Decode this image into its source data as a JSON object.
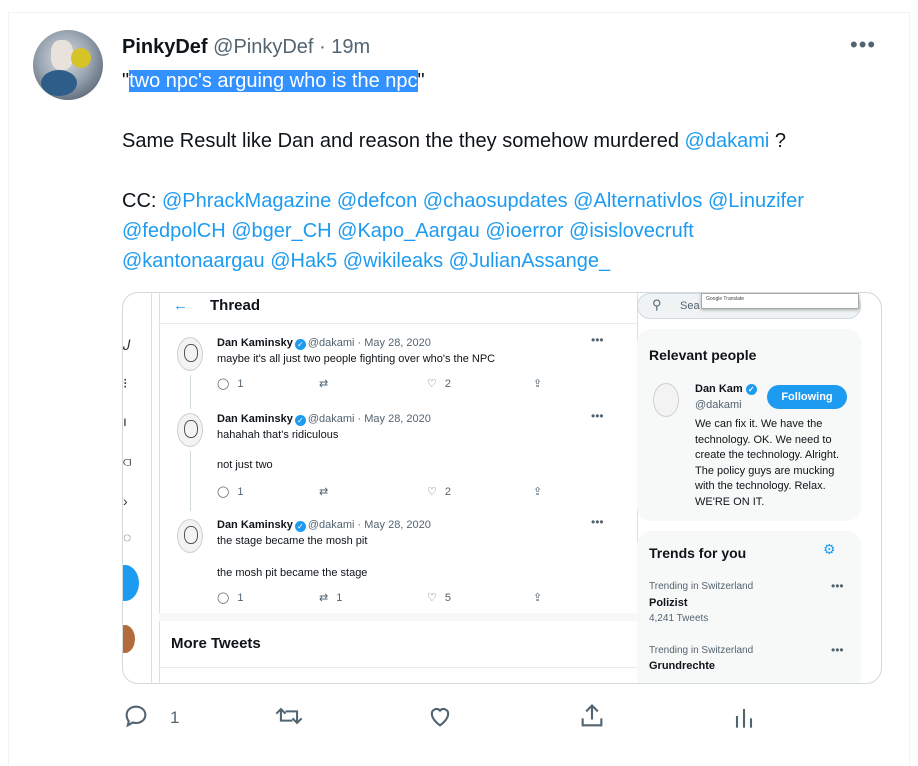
{
  "tweet": {
    "author_name": "PinkyDef",
    "author_handle": "@PinkyDef",
    "separator": "·",
    "time": "19m",
    "more_icon": "more-horizontal-icon",
    "line1_open_quote": "\"",
    "line1_highlight": "two npc's arguing who is the npc",
    "line1_close_quote": "\"",
    "line2_text": "Same Result like Dan and reason the they somehow murdered ",
    "line2_mention": "@dakami",
    "line2_suffix": " ?",
    "cc_label": "CC: ",
    "cc_line1": [
      "@PhrackMagazine",
      "@defcon",
      "@chaosupdates",
      "@Alternativlos",
      "@Linuzifer"
    ],
    "cc_line2": [
      "@fedpolCH",
      "@bger_CH",
      "@Kapo_Aargau",
      "@ioerror",
      "@isislovecruft"
    ],
    "cc_line3": [
      "@kantonaargau",
      "@Hak5",
      "@wikileaks",
      "@JulianAssange_"
    ],
    "actions": {
      "reply_count": "1",
      "reply_icon": "reply-icon",
      "retweet_icon": "retweet-icon",
      "like_icon": "like-icon",
      "share_icon": "share-icon",
      "analytics_icon": "analytics-icon"
    }
  },
  "embedded_screenshot": {
    "thread_title": "Thread",
    "back_icon": "←",
    "tweets": [
      {
        "name": "Dan Kaminsky",
        "handle": "@dakami",
        "date": "May 28, 2020",
        "body": [
          "maybe it's all just two people fighting over who's the NPC"
        ],
        "replies": "1",
        "retweets": "",
        "likes": "2"
      },
      {
        "name": "Dan Kaminsky",
        "handle": "@dakami",
        "date": "May 28, 2020",
        "body": [
          "hahahah that's ridiculous",
          "not just two"
        ],
        "replies": "1",
        "retweets": "",
        "likes": "2"
      },
      {
        "name": "Dan Kaminsky",
        "handle": "@dakami",
        "date": "May 28, 2020",
        "body": [
          "the stage became the mosh pit",
          "the mosh pit became the stage"
        ],
        "replies": "1",
        "retweets": "1",
        "likes": "5"
      }
    ],
    "more_tweets": "More Tweets",
    "search_placeholder": "Sea",
    "translate_popup": "Google Translate",
    "relevant_people": {
      "title": "Relevant people",
      "name": "Dan Kam",
      "handle": "@dakami",
      "follow_button": "Following",
      "bio": "We can fix it. We have the technology. OK. We need to create the technology. Alright. The policy guys are mucking with the technology. Relax. WE'RE ON IT."
    },
    "trends": {
      "title": "Trends for you",
      "items": [
        {
          "meta": "Trending in Switzerland",
          "name": "Polizist",
          "count": "4,241 Tweets"
        },
        {
          "meta": "Trending in Switzerland",
          "name": "Grundrechte",
          "count": ""
        }
      ]
    }
  }
}
